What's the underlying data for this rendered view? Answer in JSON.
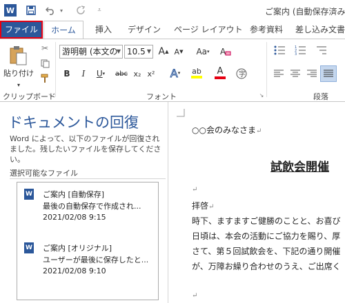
{
  "title_bar": {
    "app_icon": "W",
    "doc_title": "ご案内 (自動保存済み)"
  },
  "tabs": {
    "file": "ファイル",
    "home": "ホーム",
    "insert": "挿入",
    "design": "デザイン",
    "page_layout": "ページ レイアウト",
    "references": "参考資料",
    "mailings": "差し込み文書"
  },
  "ribbon": {
    "clipboard": {
      "paste_label": "貼り付け",
      "group_label": "クリップボード"
    },
    "font": {
      "font_name": "游明朝 (本文の",
      "font_size": "10.5",
      "grow": "A",
      "shrink": "A",
      "case": "Aa",
      "bold": "B",
      "italic": "I",
      "underline": "U",
      "strike": "abc",
      "subscript": "x₂",
      "superscript": "x²",
      "effects": "A",
      "highlight": "ab",
      "font_color": "A",
      "group_label": "フォント"
    },
    "paragraph": {
      "group_label": "段落"
    }
  },
  "recovery_pane": {
    "title": "ドキュメントの回復",
    "description": "Word によって、以下のファイルが回復されました。残したいファイルを保存してください。",
    "available_label": "選択可能なファイル",
    "files": [
      {
        "name": "ご案内  [自動保存]",
        "detail": "最後の自動保存で作成され...",
        "date": "2021/02/08 9:15"
      },
      {
        "name": "ご案内  [オリジナル]",
        "detail": "ユーザーが最後に保存したと...",
        "date": "2021/02/08 9:10"
      }
    ]
  },
  "document": {
    "salutation": "○○会のみなさま",
    "heading": "試飲会開催",
    "greeting": "拝啓",
    "lines": [
      "時下、ますますご健勝のことと、お喜び",
      "日頃は、本会の活動にご協力を賜り、厚",
      "さて、第５回試飲会を、下記の通り開催",
      "が、万障お繰り合わせのうえ、ご出席く"
    ],
    "return_mark": "↵"
  },
  "colors": {
    "accent": "#2b579a",
    "highlight_border": "#e60012"
  }
}
